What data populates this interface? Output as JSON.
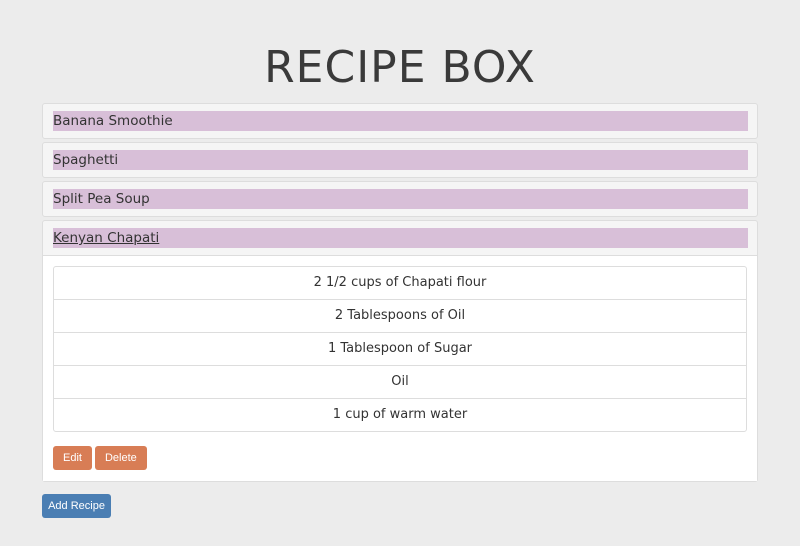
{
  "title": "RECIPE BOX",
  "recipes": [
    {
      "name": "Banana Smoothie"
    },
    {
      "name": "Spaghetti"
    },
    {
      "name": "Split Pea Soup"
    },
    {
      "name": "Kenyan Chapati",
      "ingredients": [
        "2 1/2 cups of Chapati flour",
        "2 Tablespoons of Oil",
        "1 Tablespoon of Sugar",
        "Oil",
        "1 cup of warm water"
      ]
    }
  ],
  "buttons": {
    "edit": "Edit",
    "delete": "Delete",
    "add": "Add Recipe"
  },
  "colors": {
    "titlebar": "#d8bfd8",
    "edit": "#d87d55",
    "add": "#4a7eb3"
  }
}
